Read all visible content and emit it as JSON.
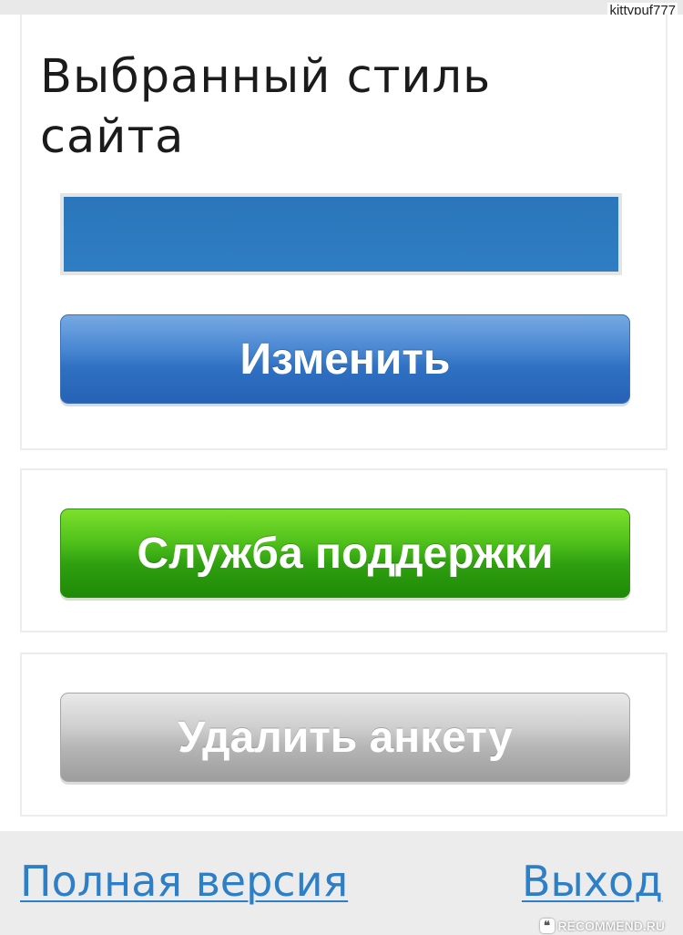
{
  "watermark": {
    "username": "kittypuf777",
    "site": "RECOMMEND.RU",
    "icon": "quote-icon"
  },
  "style_panel": {
    "title": "Выбранный стиль сайта",
    "selected_color": "#2d7ac0",
    "change_label": "Изменить"
  },
  "support": {
    "label": "Служба поддержки"
  },
  "delete": {
    "label": "Удалить анкету"
  },
  "footer": {
    "full_version": "Полная версия",
    "exit": "Выход"
  },
  "colors": {
    "accent_blue": "#2f70c2",
    "accent_green": "#2fa010",
    "neutral_gray": "#b5b5b5",
    "link": "#2d7fc7"
  }
}
